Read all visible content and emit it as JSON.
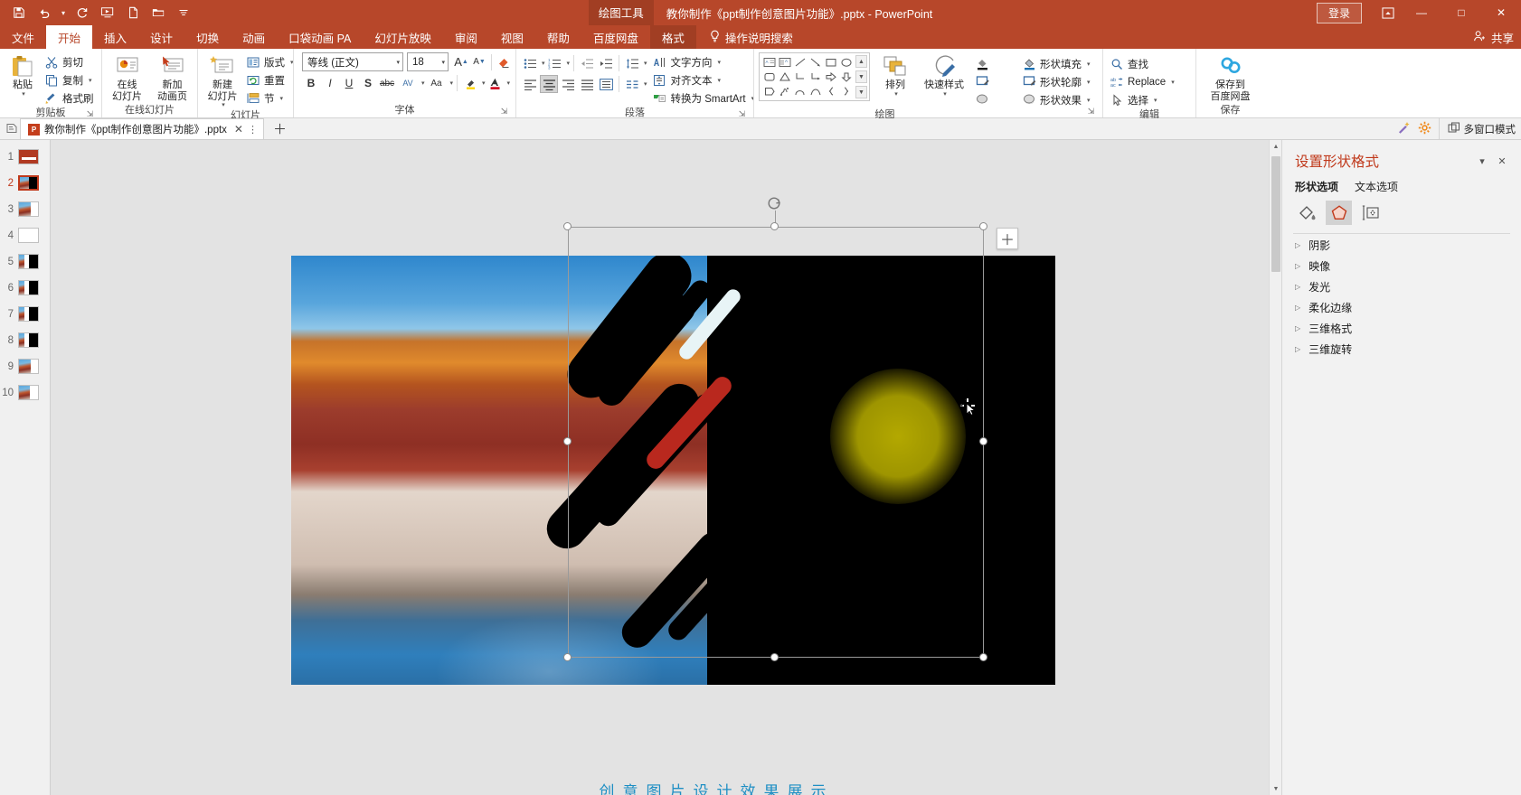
{
  "titlebar": {
    "quick_access": [
      {
        "name": "save-icon",
        "label": "保存"
      },
      {
        "name": "undo-icon",
        "label": "撤消"
      },
      {
        "name": "undo-dropdown-caret",
        "label": "撤消下拉"
      },
      {
        "name": "redo-icon",
        "label": "恢复"
      },
      {
        "name": "start-slideshow-icon",
        "label": "从头开始放映"
      },
      {
        "name": "new-file-icon",
        "label": "新建"
      },
      {
        "name": "open-folder-icon",
        "label": "打开"
      },
      {
        "name": "customize-qat-icon",
        "label": "自定义快速访问工具栏"
      }
    ],
    "context_tool": "绘图工具",
    "document_title": "教你制作《ppt制作创意图片功能》.pptx  -  PowerPoint",
    "signin": "登录",
    "ribbon_display_icon": "ribbon-display-options-icon",
    "minimize": "—",
    "maximize": "□",
    "close": "✕"
  },
  "tabs": {
    "items": [
      {
        "label": "文件",
        "state": "normal"
      },
      {
        "label": "开始",
        "state": "active"
      },
      {
        "label": "插入",
        "state": "normal"
      },
      {
        "label": "设计",
        "state": "normal"
      },
      {
        "label": "切换",
        "state": "normal"
      },
      {
        "label": "动画",
        "state": "normal"
      },
      {
        "label": "口袋动画 PA",
        "state": "normal"
      },
      {
        "label": "幻灯片放映",
        "state": "normal"
      },
      {
        "label": "审阅",
        "state": "normal"
      },
      {
        "label": "视图",
        "state": "normal"
      },
      {
        "label": "帮助",
        "state": "normal"
      },
      {
        "label": "百度网盘",
        "state": "normal"
      },
      {
        "label": "格式",
        "state": "context-active"
      }
    ],
    "tell_me": "操作说明搜索",
    "share": "共享"
  },
  "ribbon": {
    "groups": [
      {
        "name": "clipboard",
        "label": "剪贴板",
        "paste": "粘贴",
        "items": [
          {
            "label": "剪切",
            "icon": "scissors-icon"
          },
          {
            "label": "复制",
            "icon": "copy-icon",
            "caret": true
          },
          {
            "label": "格式刷",
            "icon": "format-painter-icon"
          }
        ]
      },
      {
        "name": "online-slides",
        "label": "在线幻灯片",
        "buttons": [
          {
            "label_top": "在线",
            "label_bottom": "幻灯片",
            "icon": "online-slide-icon",
            "caret": true
          },
          {
            "label_top": "新加",
            "label_bottom": "动画页",
            "icon": "new-animation-page-icon",
            "caret": true
          }
        ]
      },
      {
        "name": "slides",
        "label": "幻灯片",
        "new_slide_top": "新建",
        "new_slide_bottom": "幻灯片",
        "items": [
          {
            "label": "版式",
            "icon": "layout-icon",
            "caret": true
          },
          {
            "label": "重置",
            "icon": "reset-icon"
          },
          {
            "label": "节",
            "icon": "section-icon",
            "caret": true
          }
        ]
      },
      {
        "name": "font",
        "label": "字体",
        "font_name": "等线 (正文)",
        "font_size": "18",
        "grow_font": "A",
        "shrink_font": "A",
        "clear_formatting": "clear-format-icon",
        "row2": [
          "B",
          "I",
          "U",
          "S",
          "abc",
          "AV",
          "Aa"
        ],
        "text_highlight": "text-highlight-icon",
        "font_color": "font-color-icon"
      },
      {
        "name": "paragraph",
        "label": "段落",
        "items": [
          {
            "label": "文字方向",
            "icon": "text-direction-icon",
            "caret": true
          },
          {
            "label": "对齐文本",
            "icon": "align-text-icon",
            "caret": true
          },
          {
            "label": "转换为 SmartArt",
            "icon": "smartart-icon",
            "caret": true
          }
        ]
      },
      {
        "name": "drawing",
        "label": "绘图",
        "arrange": "排列",
        "quick_styles": "快速样式",
        "shape_fill": "形状填充",
        "shape_outline": "形状轮廓",
        "shape_effects": "形状效果"
      },
      {
        "name": "editing",
        "label": "编辑",
        "items": [
          {
            "label": "查找",
            "icon": "search-icon"
          },
          {
            "label": "Replace",
            "icon": "replace-icon",
            "caret": true
          },
          {
            "label": "选择",
            "icon": "select-icon",
            "caret": true
          }
        ]
      },
      {
        "name": "save",
        "label": "保存",
        "button_top": "保存到",
        "button_bottom": "百度网盘",
        "icon": "baidu-netdisk-icon"
      }
    ]
  },
  "doctabbar": {
    "tab_label": "教你制作《ppt制作创意图片功能》.pptx",
    "close_icon": "✕",
    "more_icon": "⋮",
    "new_tab_icon": "＋",
    "wand_icon": "magic-wand-icon",
    "gear_icon": "gear-icon",
    "multiwindow": "多窗口模式"
  },
  "thumbnails": {
    "slides": [
      {
        "num": "1",
        "selected": false,
        "style": "red-title"
      },
      {
        "num": "2",
        "selected": true,
        "style": "photo-black"
      },
      {
        "num": "3",
        "selected": false,
        "style": "photo-small"
      },
      {
        "num": "4",
        "selected": false,
        "style": "blank"
      },
      {
        "num": "5",
        "selected": false,
        "style": "half-black"
      },
      {
        "num": "6",
        "selected": false,
        "style": "half-black"
      },
      {
        "num": "7",
        "selected": false,
        "style": "half-black"
      },
      {
        "num": "8",
        "selected": false,
        "style": "half-black"
      },
      {
        "num": "9",
        "selected": false,
        "style": "photo-small"
      },
      {
        "num": "10",
        "selected": false,
        "style": "photo-small"
      }
    ]
  },
  "canvas": {
    "slide_bg": "#ffffff",
    "black_shape_color": "#000000",
    "glow_color": "#b3a800",
    "selection": {
      "rotate_handle": "rotate-handle",
      "handle_count": 8
    },
    "plus_button": "＋",
    "cursor": "move-cursor"
  },
  "format_pane": {
    "title": "设置形状格式",
    "collapse_icon": "▾",
    "close_icon": "✕",
    "tabs": [
      {
        "label": "形状选项",
        "active": true
      },
      {
        "label": "文本选项",
        "active": false
      }
    ],
    "icon_tabs": [
      {
        "name": "fill-line-icon",
        "selected": false
      },
      {
        "name": "effects-pentagon-icon",
        "selected": true
      },
      {
        "name": "size-properties-icon",
        "selected": false
      }
    ],
    "sections": [
      {
        "label": "阴影"
      },
      {
        "label": "映像"
      },
      {
        "label": "发光"
      },
      {
        "label": "柔化边缘"
      },
      {
        "label": "三维格式"
      },
      {
        "label": "三维旋转"
      }
    ]
  },
  "bottom_text": "创意图片设计效果展示"
}
